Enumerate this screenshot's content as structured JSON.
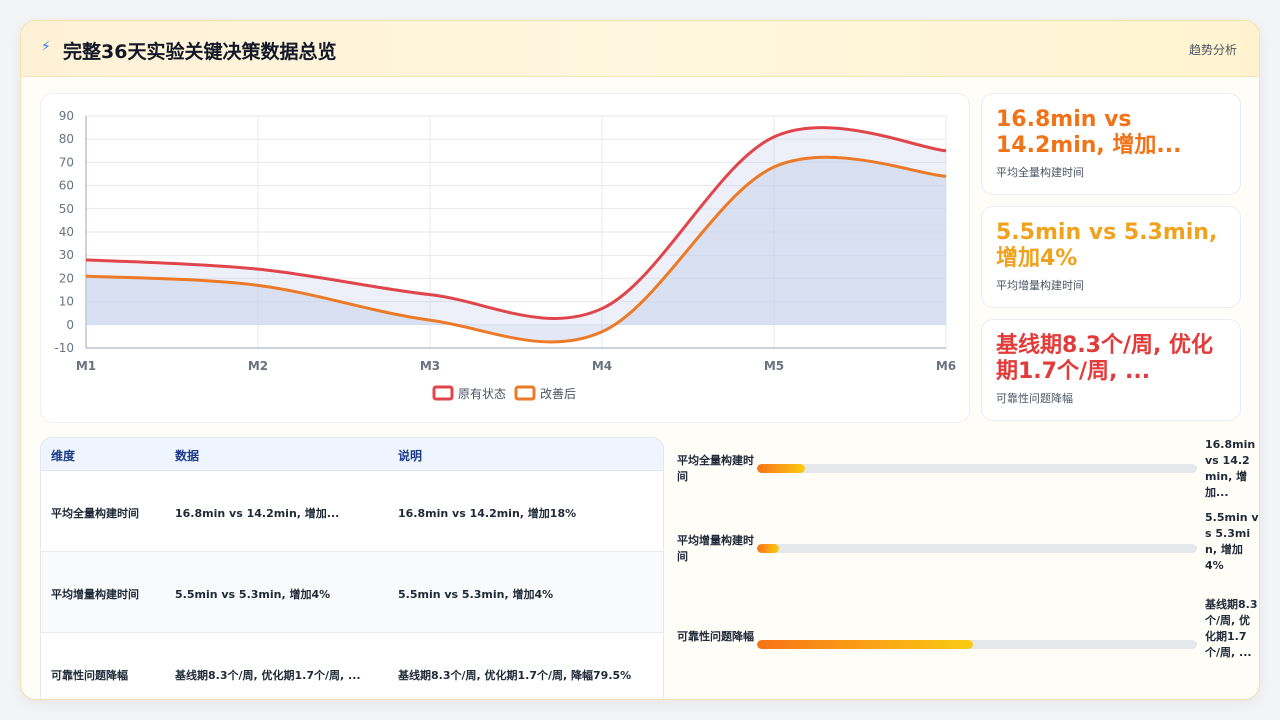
{
  "header": {
    "icon": "lightning-icon",
    "title": "完整36天实验关键决策数据总览",
    "link": "趋势分析"
  },
  "colors": {
    "series_original": "#e0454b",
    "series_improved": "#ec7a27",
    "kpi_1": "#f07318",
    "kpi_2": "#f0a21d",
    "kpi_3": "#e33a3a"
  },
  "chart_data": {
    "type": "area",
    "x": [
      "M1",
      "M2",
      "M3",
      "M4",
      "M5",
      "M6"
    ],
    "yticks": [
      90,
      80,
      70,
      60,
      50,
      40,
      30,
      20,
      10,
      0,
      -10
    ],
    "ylim": [
      -10,
      90
    ],
    "grid": true,
    "legend_position": "bottom",
    "series": [
      {
        "name": "原有状态",
        "values": [
          28,
          24,
          13,
          7,
          81,
          75
        ]
      },
      {
        "name": "改善后",
        "values": [
          21,
          17,
          2,
          -3,
          68,
          64
        ]
      }
    ]
  },
  "kpis": [
    {
      "value": "16.8min vs 14.2min, 增加...",
      "label": "平均全量构建时间"
    },
    {
      "value": "5.5min vs 5.3min, 增加4%",
      "label": "平均增量构建时间"
    },
    {
      "value": "基线期8.3个/周, 优化期1.7个/周, ...",
      "label": "可靠性问题降幅"
    }
  ],
  "table": {
    "headers": [
      "维度",
      "数据",
      "说明"
    ],
    "rows": [
      [
        "平均全量构建时间",
        "16.8min vs 14.2min, 增加...",
        "16.8min vs 14.2min, 增加18%"
      ],
      [
        "平均增量构建时间",
        "5.5min vs 5.3min, 增加4%",
        "5.5min vs 5.3min, 增加4%"
      ],
      [
        "可靠性问题降幅",
        "基线期8.3个/周, 优化期1.7个/周, ...",
        "基线期8.3个/周, 优化期1.7个/周, 降幅79.5%"
      ]
    ]
  },
  "bars": [
    {
      "label": "平均全量构建时间",
      "fill": 0.11,
      "value": "16.8min vs 14.2min, 增加..."
    },
    {
      "label": "平均增量构建时间",
      "fill": 0.05,
      "value": "5.5min vs 5.3min, 增加4%"
    },
    {
      "label": "可靠性问题降幅",
      "fill": 0.49,
      "value": "基线期8.3个/周, 优化期1.7个/周, ..."
    }
  ]
}
